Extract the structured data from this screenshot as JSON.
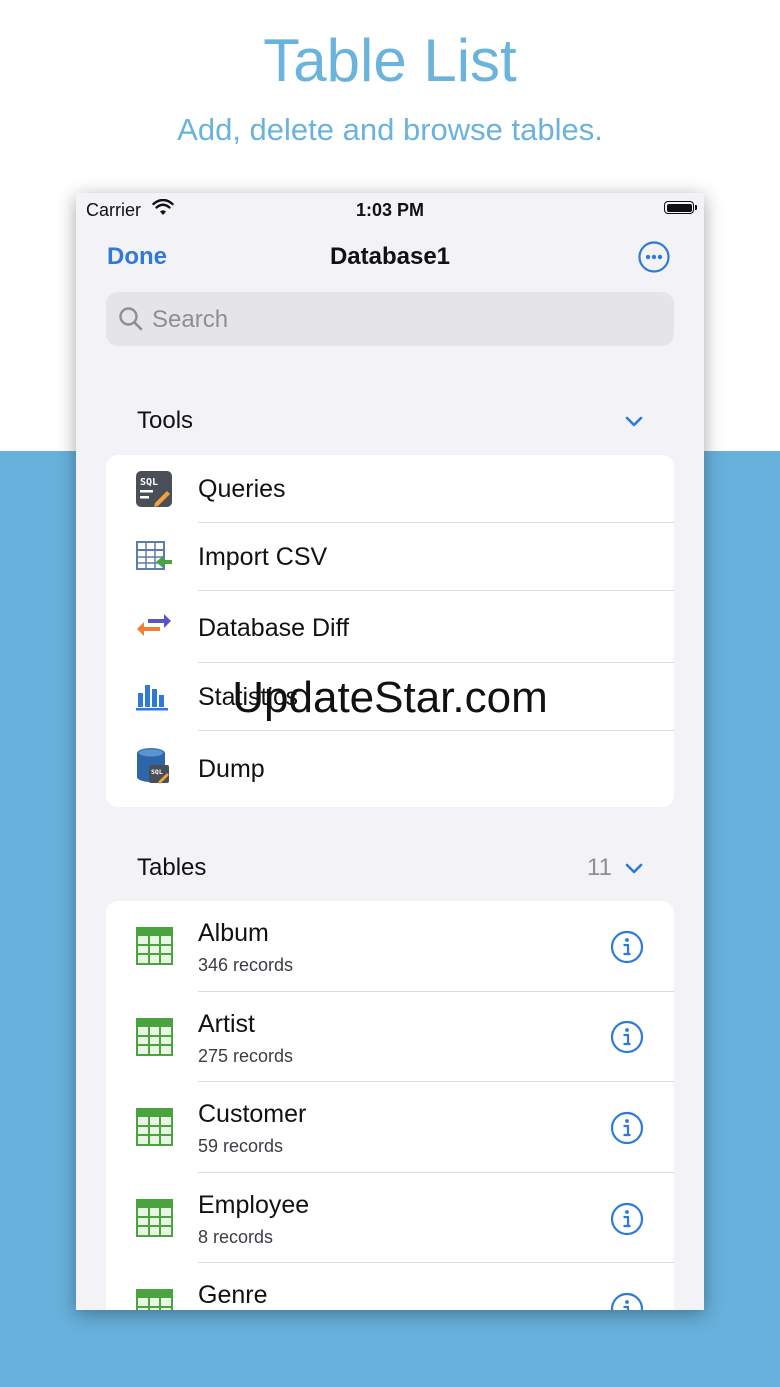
{
  "promo": {
    "title": "Table List",
    "subtitle": "Add, delete and browse tables."
  },
  "status_bar": {
    "carrier": "Carrier",
    "time": "1:03 PM"
  },
  "nav": {
    "done_label": "Done",
    "title": "Database1"
  },
  "search": {
    "placeholder": "Search"
  },
  "tools": {
    "header": "Tools",
    "items": [
      {
        "label": "Queries",
        "icon": "sql-queries-icon"
      },
      {
        "label": "Import CSV",
        "icon": "import-csv-icon"
      },
      {
        "label": "Database Diff",
        "icon": "database-diff-icon"
      },
      {
        "label": "Statistics",
        "icon": "statistics-icon"
      },
      {
        "label": "Dump",
        "icon": "dump-icon"
      }
    ]
  },
  "tables": {
    "header": "Tables",
    "count": "11",
    "items": [
      {
        "name": "Album",
        "records": "346 records"
      },
      {
        "name": "Artist",
        "records": "275 records"
      },
      {
        "name": "Customer",
        "records": "59 records"
      },
      {
        "name": "Employee",
        "records": "8 records"
      },
      {
        "name": "Genre",
        "records": ""
      }
    ]
  },
  "watermark": "UpdateStar.com",
  "colors": {
    "accent": "#2f7ad9",
    "promo_text": "#6ab3dc",
    "promo_bg": "#67b1dc",
    "table_icon": "#4aa33e"
  }
}
